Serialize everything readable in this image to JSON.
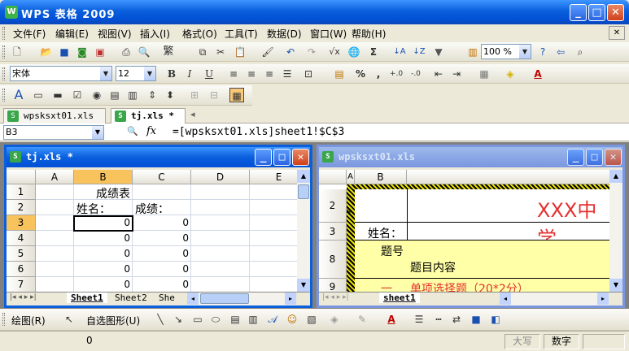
{
  "app": {
    "title": "WPS 表格 2009"
  },
  "menu": [
    "文件(F)",
    "编辑(E)",
    "视图(V)",
    "插入(I)",
    "格式(O)",
    "工具(T)",
    "数据(D)",
    "窗口(W)",
    "帮助(H)"
  ],
  "toolbar": {
    "zoom": "100 %",
    "font": "宋体",
    "font_size": "12"
  },
  "doc_tabs": [
    "wpsksxt01.xls",
    "tj.xls *"
  ],
  "formula_bar": {
    "name_box": "B3",
    "fx": "fx",
    "formula": "=[wpsksxt01.xls]sheet1!$C$3"
  },
  "left_window": {
    "title": "tj.xls *",
    "columns": [
      "A",
      "B",
      "C",
      "D",
      "E"
    ],
    "rows": [
      "1",
      "2",
      "3",
      "4",
      "5",
      "6",
      "7"
    ],
    "cells": {
      "b1": "成绩表",
      "b2": "姓名：",
      "c2": "成绩：",
      "b3": "0",
      "c3": "0",
      "b4": "0",
      "c4": "0",
      "b5": "0",
      "c5": "0",
      "b6": "0",
      "c6": "0",
      "b7": "0",
      "c7": "0"
    },
    "sheets": [
      "Sheet1",
      "Sheet2",
      "She"
    ]
  },
  "right_window": {
    "title": "wpsksxt01.xls",
    "columns": [
      "A",
      "B"
    ],
    "rows": [
      "2",
      "3",
      "8",
      "9"
    ],
    "cells": {
      "header": "XXX中学",
      "name_label": "姓名：",
      "q_no": "题号",
      "q_content": "题目内容",
      "row9_a": "一",
      "row9_b": "单项选择题（20*2分）",
      "row2_a": "¥"
    },
    "sheets": [
      "sheet1"
    ]
  },
  "draw_toolbar": {
    "draw": "绘图(R)",
    "autoshape": "自选图形(U)"
  },
  "status": {
    "value": "0",
    "caps": "大写",
    "num": "数字"
  },
  "colors": {
    "title_blue": "#0a5fdc",
    "selected_header": "#f8c25c",
    "accent_red": "#e53030",
    "yellow_cell": "#ffffa8"
  }
}
